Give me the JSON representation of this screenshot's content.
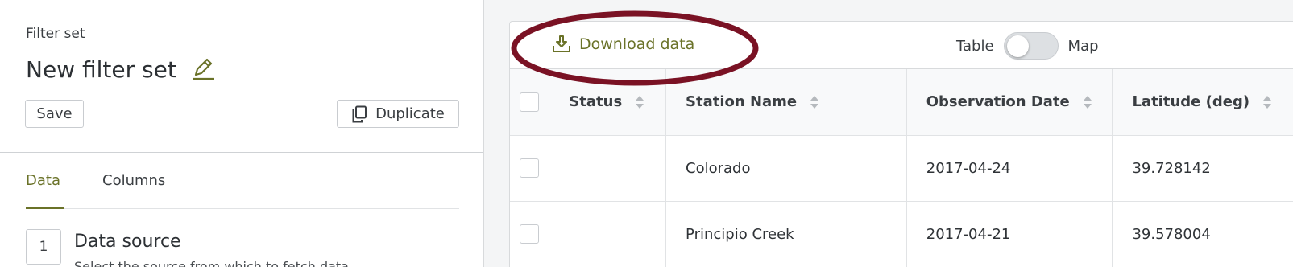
{
  "left_panel": {
    "filter_set_label": "Filter set",
    "filter_set_name": "New filter set",
    "save_label": "Save",
    "duplicate_label": "Duplicate",
    "tabs": [
      {
        "label": "Data",
        "active": true
      },
      {
        "label": "Columns",
        "active": false
      }
    ],
    "step": {
      "number": "1",
      "title": "Data source",
      "description": "Select the source from which to fetch data"
    }
  },
  "toolbar": {
    "download_label": "Download data",
    "view_toggle": {
      "left_label": "Table",
      "right_label": "Map",
      "state": "Table"
    }
  },
  "table": {
    "headers": [
      "Status",
      "Station Name",
      "Observation Date",
      "Latitude (deg)"
    ],
    "rows": [
      {
        "status": "",
        "station": "Colorado",
        "date": "2017-04-24",
        "latitude": "39.728142"
      },
      {
        "status": "",
        "station": "Principio Creek",
        "date": "2017-04-21",
        "latitude": "39.578004"
      }
    ]
  },
  "colors": {
    "accent": "#6a7228",
    "highlight_ellipse": "#7a1224"
  },
  "icons": {
    "edit": "pencil-icon",
    "duplicate": "copy-icon",
    "download": "download-tray-icon",
    "sort": "sort-icon"
  }
}
